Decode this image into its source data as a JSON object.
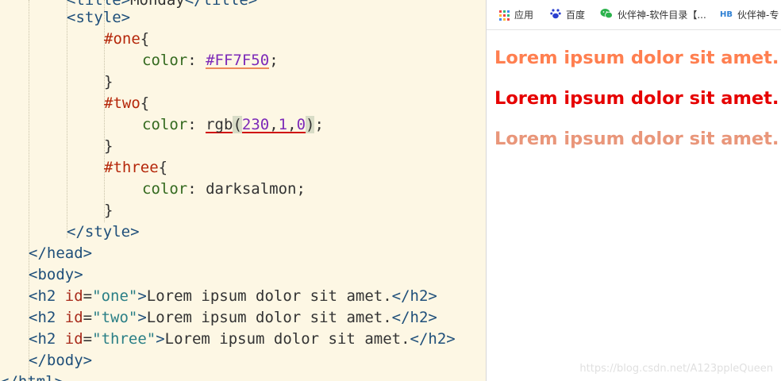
{
  "editor": {
    "lines": {
      "l0": {
        "tag_open": "<title>",
        "text": "Monday",
        "tag_close": "</title>"
      },
      "l1": "<style>",
      "l2": {
        "sel": "#one",
        "brace": "{"
      },
      "l3": {
        "prop": "color",
        "colon": ":",
        "value": "#FF7F50",
        "semi": ";"
      },
      "l4": "}",
      "l5": {
        "sel": "#two",
        "brace": "{"
      },
      "l6": {
        "prop": "color",
        "colon": ":",
        "fn": "rgb",
        "lp": "(",
        "n1": "230",
        "c1": ",",
        "n2": "1",
        "c2": ",",
        "n3": "0",
        "rp": ")",
        "semi": ";"
      },
      "l7": "}",
      "l8": {
        "sel": "#three",
        "brace": "{"
      },
      "l9": {
        "prop": "color",
        "colon": ":",
        "value": "darksalmon",
        "semi": ";"
      },
      "l10": "}",
      "l11": "</style>",
      "l12": "</head>",
      "l13": "<body>",
      "l14": {
        "open": "<h2",
        "attr": "id",
        "eq": "=",
        "val": "\"one\"",
        "gt": ">",
        "text": "Lorem ipsum dolor sit amet.",
        "close": "</h2>"
      },
      "l15": {
        "open": "<h2",
        "attr": "id",
        "eq": "=",
        "val": "\"two\"",
        "gt": ">",
        "text": "Lorem ipsum dolor sit amet.",
        "close": "</h2>"
      },
      "l16": {
        "open": "<h2",
        "attr": "id",
        "eq": "=",
        "val": "\"three\"",
        "gt": ">",
        "text": "Lorem ipsum dolor sit amet.",
        "close": "</h2>"
      },
      "l17": "</body>",
      "l18": "</html>"
    }
  },
  "browser": {
    "bookmarks": [
      {
        "label": "应用",
        "icon": "apps-grid-icon"
      },
      {
        "label": "百度",
        "icon": "baidu-paw-icon"
      },
      {
        "label": "伙伴神-软件目录【...",
        "icon": "wechat-icon"
      },
      {
        "label": "伙伴神-专",
        "icon": "hb-logo-icon"
      }
    ],
    "headings": [
      {
        "text": "Lorem ipsum dolor sit amet.",
        "color": "#FF7F50"
      },
      {
        "text": "Lorem ipsum dolor sit amet.",
        "color": "#E60100"
      },
      {
        "text": "Lorem ipsum dolor sit amet.",
        "color": "#E9967A"
      }
    ],
    "watermark": "https://blog.csdn.net/A123ppleQueen"
  }
}
